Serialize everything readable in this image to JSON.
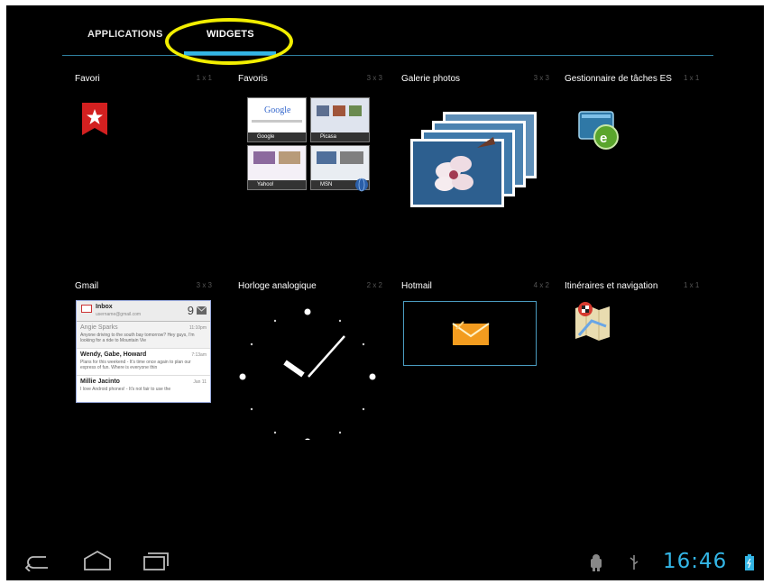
{
  "tabs": {
    "applications": "APPLICATIONS",
    "widgets": "WIDGETS"
  },
  "widgets": [
    {
      "label": "Favori",
      "size": "1 x 1"
    },
    {
      "label": "Favoris",
      "size": "3 x 3"
    },
    {
      "label": "Galerie photos",
      "size": "3 x 3"
    },
    {
      "label": "Gestionnaire de tâches ES",
      "size": "1 x 1"
    },
    {
      "label": "Gmail",
      "size": "3 x 3"
    },
    {
      "label": "Horloge analogique",
      "size": "2 x 2"
    },
    {
      "label": "Hotmail",
      "size": "4 x 2"
    },
    {
      "label": "Itinéraires et navigation",
      "size": "1 x 1"
    }
  ],
  "bookmarks_preview": {
    "google_word": "Google",
    "items": [
      "Google",
      "Picasa",
      "Yahoo!",
      "MSN"
    ]
  },
  "gmail_preview": {
    "folder": "Inbox",
    "account": "username@gmail.com",
    "count": "9",
    "messages": [
      {
        "from": "Angie Sparks",
        "time": "11:10pm",
        "snippet": "Anyone driving to the south bay tomorrow? Hey guys, I'm looking for a ride to Mountain Vie"
      },
      {
        "from": "Wendy, Gabe, Howard",
        "time": "7:13am",
        "snippet": "Plans for this weekend - It's time once again to plan our express of fun. Where is everyone thin"
      },
      {
        "from": "Millie Jacinto",
        "time": "Jan 11",
        "snippet": "I love Android phones! - It's not fair to use the"
      }
    ]
  },
  "status": {
    "time": "16:46"
  },
  "colors": {
    "accent": "#33b5e5",
    "highlight": "#f2ee00",
    "background": "#000000"
  },
  "icons": [
    "back-icon",
    "home-icon",
    "recent-apps-icon",
    "android-debug-icon",
    "usb-icon",
    "battery-icon"
  ]
}
